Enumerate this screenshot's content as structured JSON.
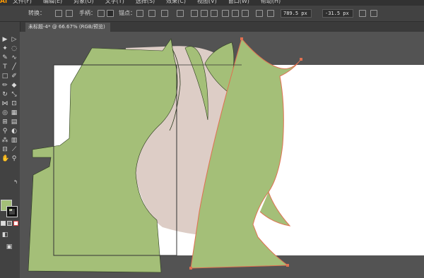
{
  "app": {
    "logo": "Ai"
  },
  "menu": {
    "items": [
      "文件(F)",
      "编辑(E)",
      "对象(O)",
      "文字(T)",
      "选择(S)",
      "效果(C)",
      "视图(V)",
      "窗口(W)",
      "帮助(H)"
    ]
  },
  "control_bar": {
    "convert_label": "转换：",
    "handle_label": "手柄：",
    "anchor_label": "锚点：",
    "x_value": "789.5 px",
    "y_value": "-31.5 px"
  },
  "document": {
    "tab_title": "未标题-4* @ 66.67% (RGB/预览)"
  },
  "colors": {
    "fill": "#a4bf78",
    "stroke": "#111111",
    "accent": "#ff9a00"
  }
}
